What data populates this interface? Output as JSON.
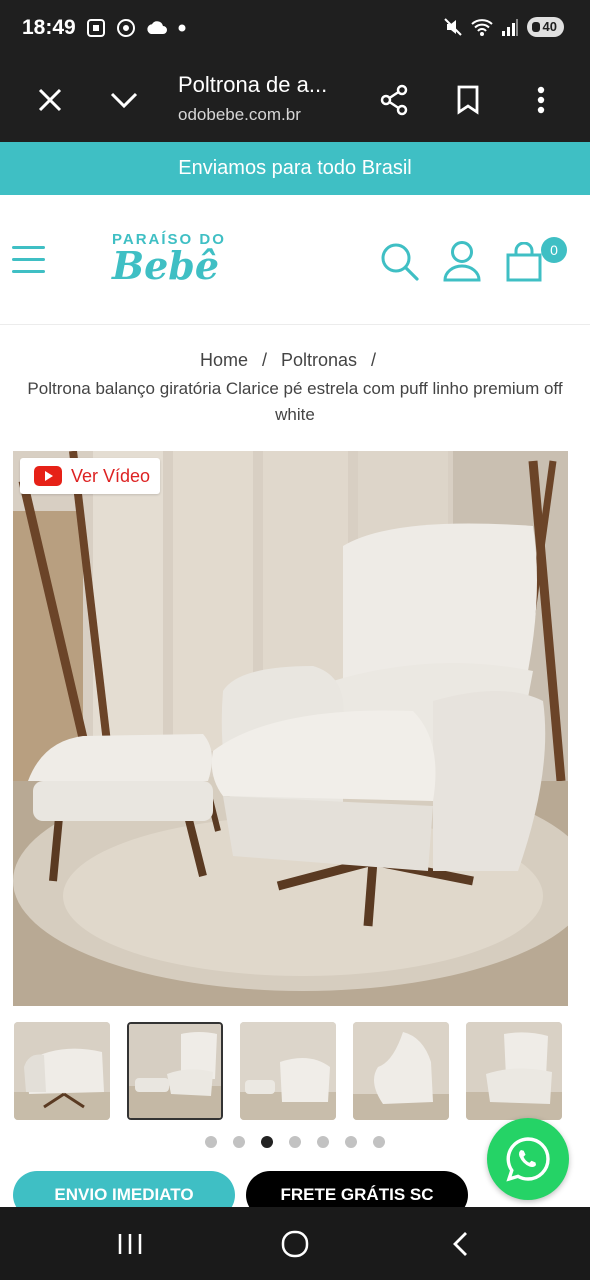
{
  "status_bar": {
    "time": "18:49",
    "battery": "40"
  },
  "browser": {
    "title": "Poltrona de a...",
    "url": "odobebe.com.br"
  },
  "banner": {
    "text": "Enviamos para todo Brasil"
  },
  "header": {
    "logo_top": "PARAÍSO DO",
    "logo_main": "Bebê",
    "cart_count": "0"
  },
  "breadcrumb": {
    "items": [
      "Home",
      "Poltronas"
    ],
    "separator": "/"
  },
  "product": {
    "title": "Poltrona balanço giratória Clarice pé estrela com puff linho premium off white",
    "video_label": "Ver Vídeo",
    "thumbnail_count": 5,
    "active_thumbnail": 2,
    "carousel_dots": 7,
    "active_dot": 3
  },
  "badges": {
    "shipping_immediate": "ENVIO IMEDIATO",
    "free_shipping": "FRETE GRÁTIS SC"
  },
  "colors": {
    "brand_teal": "#3fbfc4",
    "whatsapp_green": "#25d366",
    "dark_bar": "#1f1f1f"
  }
}
